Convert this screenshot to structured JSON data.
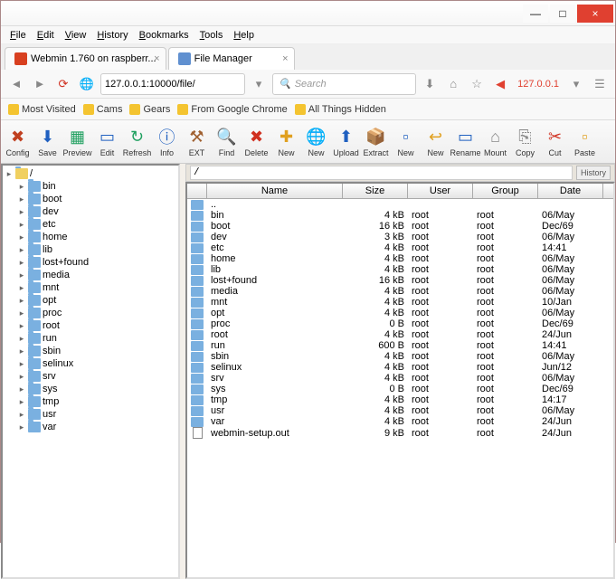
{
  "window": {
    "min": "—",
    "max": "□",
    "close": "×"
  },
  "menu": [
    "File",
    "Edit",
    "View",
    "History",
    "Bookmarks",
    "Tools",
    "Help"
  ],
  "tabs": [
    {
      "label": "Webmin 1.760 on raspberr...",
      "active": false,
      "color": "#d84020"
    },
    {
      "label": "File Manager",
      "active": true,
      "color": "#6090d0"
    }
  ],
  "url": {
    "text": "127.0.0.1:10000/file/",
    "search": "Search",
    "ip": "127.0.0.1"
  },
  "bookmarks": [
    "Most Visited",
    "Cams",
    "Gears",
    "From Google Chrome",
    "All Things Hidden"
  ],
  "toolbar": [
    {
      "l": "Config",
      "i": "✖",
      "c": "#c04020"
    },
    {
      "l": "Save",
      "i": "⬇",
      "c": "#2060c0"
    },
    {
      "l": "Preview",
      "i": "▦",
      "c": "#20a060"
    },
    {
      "l": "Edit",
      "i": "▭",
      "c": "#2060c0"
    },
    {
      "l": "Refresh",
      "i": "↻",
      "c": "#20a060"
    },
    {
      "l": "Info",
      "i": "ⓘ",
      "c": "#2060c0"
    },
    {
      "l": "EXT",
      "i": "⚒",
      "c": "#a06030"
    },
    {
      "l": "Find",
      "i": "🔍",
      "c": "#888"
    },
    {
      "l": "Delete",
      "i": "✖",
      "c": "#d03020"
    },
    {
      "l": "New",
      "i": "✚",
      "c": "#e0a020"
    },
    {
      "l": "New",
      "i": "🌐",
      "c": "#e06020"
    },
    {
      "l": "Upload",
      "i": "⬆",
      "c": "#2060c0"
    },
    {
      "l": "Extract",
      "i": "📦",
      "c": "#b07030"
    },
    {
      "l": "New",
      "i": "▫",
      "c": "#2060c0"
    },
    {
      "l": "New",
      "i": "↩",
      "c": "#e0a020"
    },
    {
      "l": "Rename",
      "i": "▭",
      "c": "#2060c0"
    },
    {
      "l": "Mount",
      "i": "⌂",
      "c": "#888"
    },
    {
      "l": "Copy",
      "i": "⎘",
      "c": "#888"
    },
    {
      "l": "Cut",
      "i": "✂",
      "c": "#d03020"
    },
    {
      "l": "Paste",
      "i": "▫",
      "c": "#e0a020"
    }
  ],
  "tree": {
    "root": "/",
    "items": [
      "bin",
      "boot",
      "dev",
      "etc",
      "home",
      "lib",
      "lost+found",
      "media",
      "mnt",
      "opt",
      "proc",
      "root",
      "run",
      "sbin",
      "selinux",
      "srv",
      "sys",
      "tmp",
      "usr",
      "var"
    ]
  },
  "path": "/",
  "history": "History",
  "cols": {
    "name": "Name",
    "size": "Size",
    "user": "User",
    "group": "Group",
    "date": "Date"
  },
  "files": [
    {
      "n": "..",
      "s": "",
      "u": "",
      "g": "",
      "d": "",
      "t": "d"
    },
    {
      "n": "bin",
      "s": "4 kB",
      "u": "root",
      "g": "root",
      "d": "06/May",
      "t": "d"
    },
    {
      "n": "boot",
      "s": "16 kB",
      "u": "root",
      "g": "root",
      "d": "Dec/69",
      "t": "d"
    },
    {
      "n": "dev",
      "s": "3 kB",
      "u": "root",
      "g": "root",
      "d": "06/May",
      "t": "d"
    },
    {
      "n": "etc",
      "s": "4 kB",
      "u": "root",
      "g": "root",
      "d": "14:41",
      "t": "d"
    },
    {
      "n": "home",
      "s": "4 kB",
      "u": "root",
      "g": "root",
      "d": "06/May",
      "t": "d"
    },
    {
      "n": "lib",
      "s": "4 kB",
      "u": "root",
      "g": "root",
      "d": "06/May",
      "t": "d"
    },
    {
      "n": "lost+found",
      "s": "16 kB",
      "u": "root",
      "g": "root",
      "d": "06/May",
      "t": "d"
    },
    {
      "n": "media",
      "s": "4 kB",
      "u": "root",
      "g": "root",
      "d": "06/May",
      "t": "d"
    },
    {
      "n": "mnt",
      "s": "4 kB",
      "u": "root",
      "g": "root",
      "d": "10/Jan",
      "t": "d"
    },
    {
      "n": "opt",
      "s": "4 kB",
      "u": "root",
      "g": "root",
      "d": "06/May",
      "t": "d"
    },
    {
      "n": "proc",
      "s": "0 B",
      "u": "root",
      "g": "root",
      "d": "Dec/69",
      "t": "d"
    },
    {
      "n": "root",
      "s": "4 kB",
      "u": "root",
      "g": "root",
      "d": "24/Jun",
      "t": "d"
    },
    {
      "n": "run",
      "s": "600 B",
      "u": "root",
      "g": "root",
      "d": "14:41",
      "t": "d"
    },
    {
      "n": "sbin",
      "s": "4 kB",
      "u": "root",
      "g": "root",
      "d": "06/May",
      "t": "d"
    },
    {
      "n": "selinux",
      "s": "4 kB",
      "u": "root",
      "g": "root",
      "d": "Jun/12",
      "t": "d"
    },
    {
      "n": "srv",
      "s": "4 kB",
      "u": "root",
      "g": "root",
      "d": "06/May",
      "t": "d"
    },
    {
      "n": "sys",
      "s": "0 B",
      "u": "root",
      "g": "root",
      "d": "Dec/69",
      "t": "d"
    },
    {
      "n": "tmp",
      "s": "4 kB",
      "u": "root",
      "g": "root",
      "d": "14:17",
      "t": "d"
    },
    {
      "n": "usr",
      "s": "4 kB",
      "u": "root",
      "g": "root",
      "d": "06/May",
      "t": "d"
    },
    {
      "n": "var",
      "s": "4 kB",
      "u": "root",
      "g": "root",
      "d": "24/Jun",
      "t": "d"
    },
    {
      "n": "webmin-setup.out",
      "s": "9 kB",
      "u": "root",
      "g": "root",
      "d": "24/Jun",
      "t": "f"
    }
  ]
}
